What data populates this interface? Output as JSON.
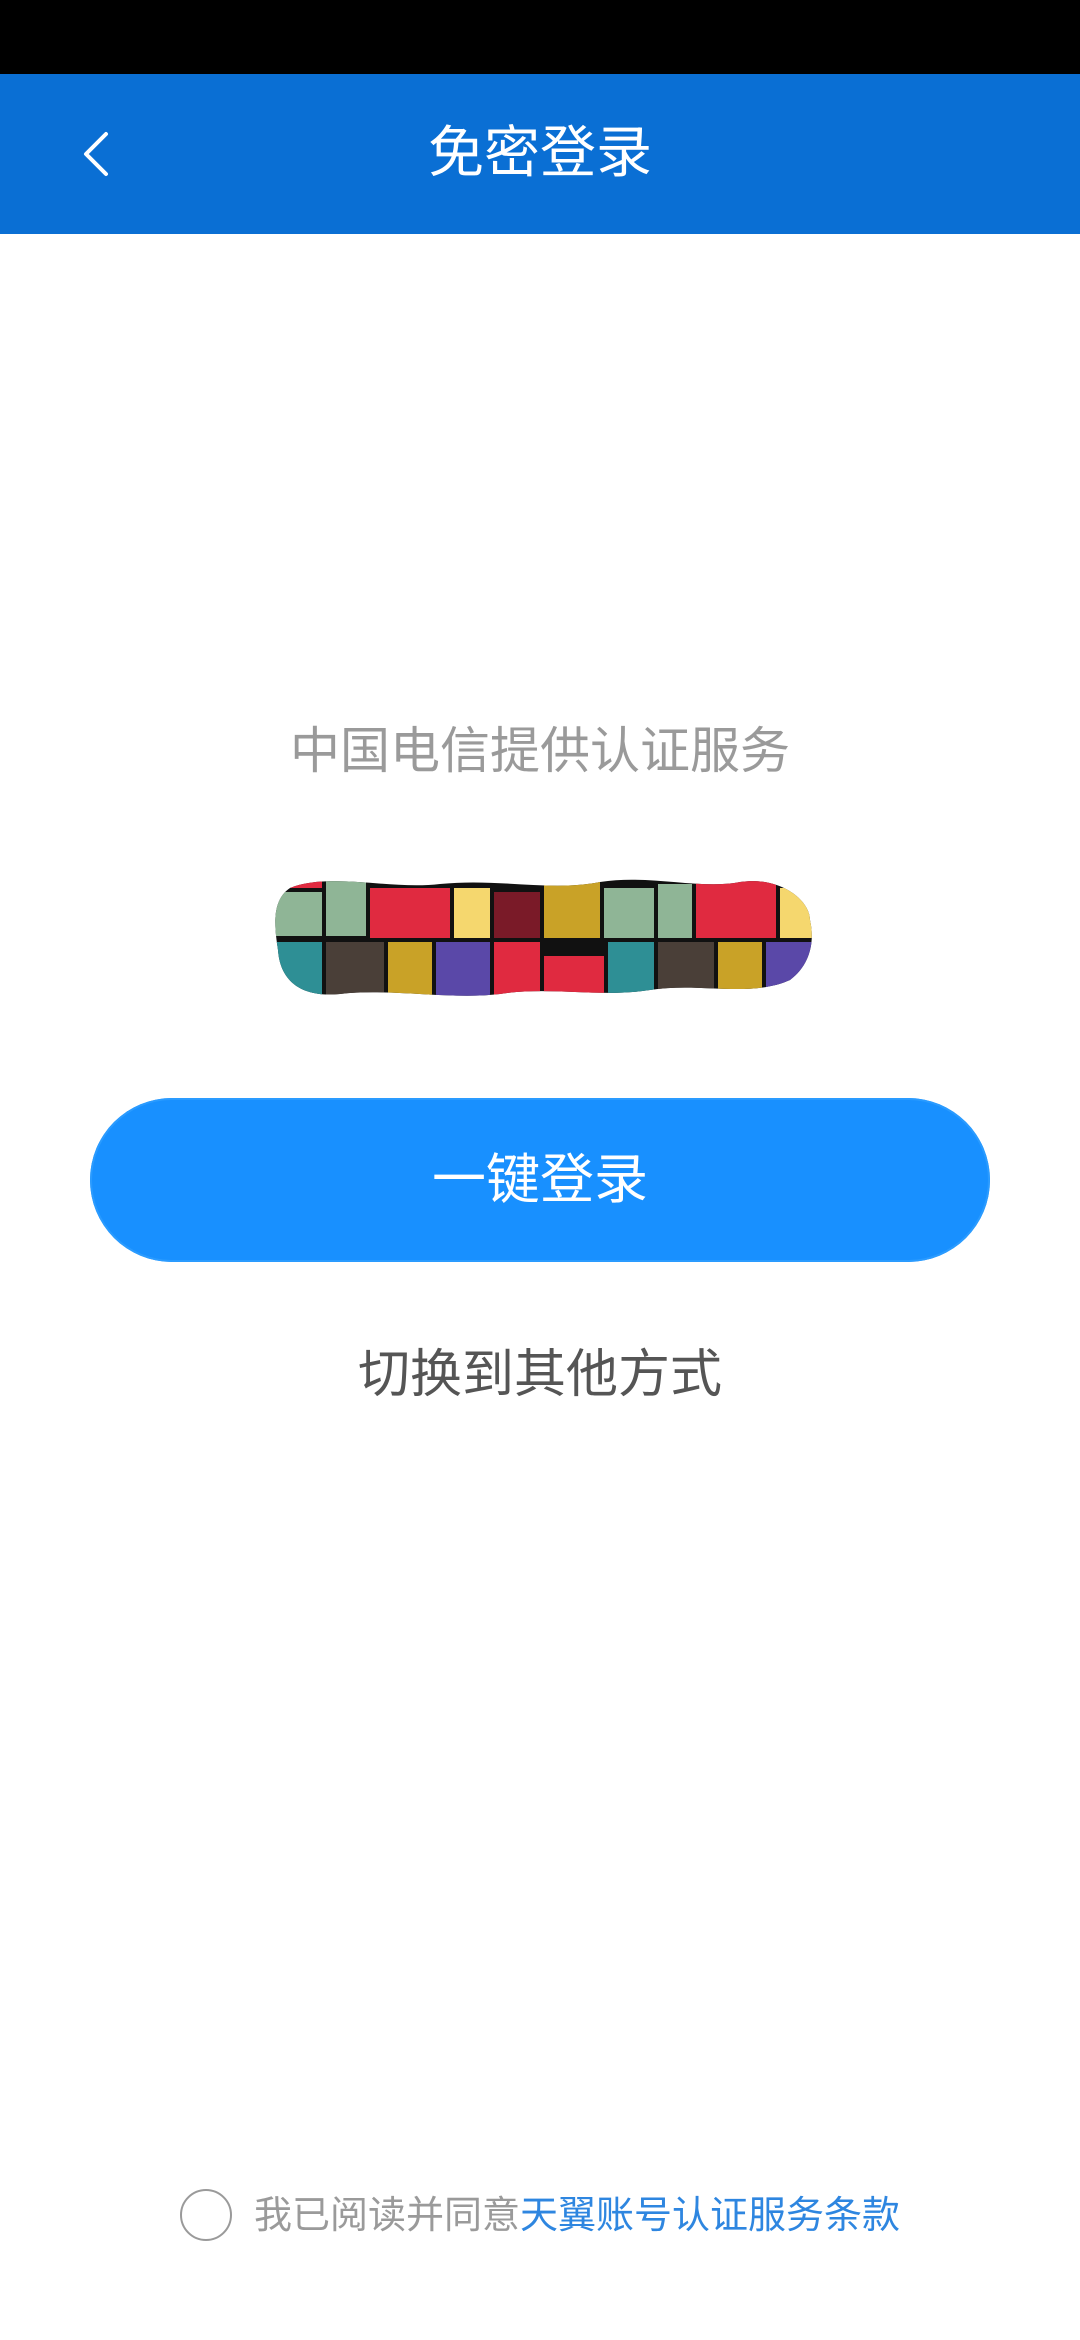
{
  "header": {
    "title": "免密登录",
    "back_icon": "chevron-left-icon"
  },
  "main": {
    "provider_text": "中国电信提供认证服务",
    "login_button_label": "一键登录",
    "switch_method_label": "切换到其他方式"
  },
  "agreement": {
    "prefix": "我已阅读并同意",
    "terms_label": "天翼账号认证服务条款",
    "checked": false
  },
  "colors": {
    "header_bg": "#0a6fd4",
    "button_bg": "#1890ff",
    "link": "#2e86e0",
    "muted_text": "#9a9a9a"
  }
}
